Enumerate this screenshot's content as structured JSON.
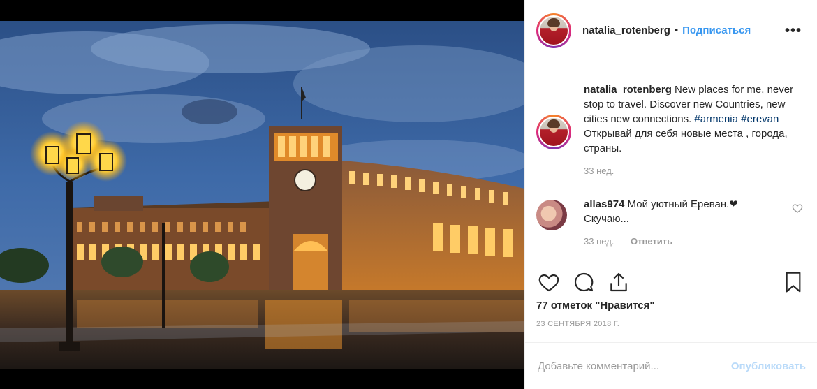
{
  "post": {
    "username": "natalia_rotenberg",
    "separator": "•",
    "follow_label": "Подписаться",
    "more_label": "•••"
  },
  "caption": {
    "username": "natalia_rotenberg",
    "text_1": " New places for me, never stop to travel. Discover new Countries, new cities new connections. ",
    "tag_1": "#armenia",
    "tag_2": "#erevan",
    "text_2": " Открывай для себя новые места , города, страны.",
    "time": "33 нед."
  },
  "comment": {
    "username": "allas974",
    "text": " Мой уютный Ереван.❤ Скучаю...",
    "time": "33 нед.",
    "reply_label": "Ответить"
  },
  "likes": "77 отметок \"Нравится\"",
  "date": "23 СЕНТЯБРЯ 2018 Г.",
  "add_comment": {
    "placeholder": "Добавьте комментарий...",
    "publish_label": "Опубликовать"
  },
  "icons": [
    "heart-icon",
    "comment-icon",
    "share-icon",
    "bookmark-icon",
    "more-icon",
    "small-heart-icon"
  ],
  "colors": {
    "accent": "#3897f0",
    "tag": "#003569",
    "meta": "#999999",
    "text": "#262626"
  }
}
